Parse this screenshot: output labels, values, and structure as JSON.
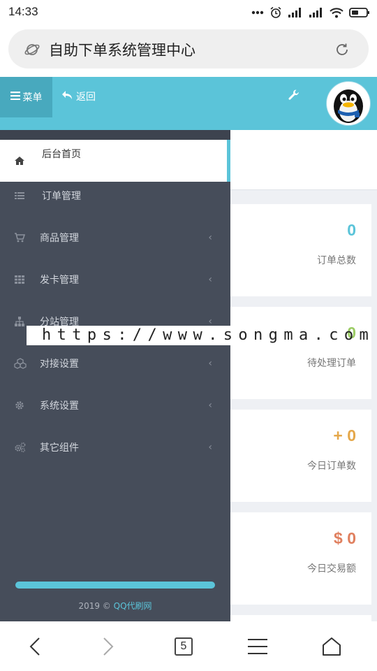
{
  "status_bar": {
    "time": "14:33"
  },
  "address_bar": {
    "title": "自助下单系统管理中心"
  },
  "header": {
    "menu_label": "菜单",
    "back_label": "返回"
  },
  "sidebar": {
    "items": [
      {
        "label": "后台首页",
        "icon": "home-icon",
        "active": true
      },
      {
        "label": "订单管理",
        "icon": "list-icon"
      },
      {
        "label": "商品管理",
        "icon": "cart-icon"
      },
      {
        "label": "发卡管理",
        "icon": "grid-icon"
      },
      {
        "label": "分站管理",
        "icon": "sitemap-icon"
      },
      {
        "label": "对接设置",
        "icon": "cubes-icon"
      },
      {
        "label": "系统设置",
        "icon": "gear-icon"
      },
      {
        "label": "其它组件",
        "icon": "gears-icon"
      }
    ],
    "footer_year": "2019 ©",
    "footer_brand": "QQ代刷网"
  },
  "stats": [
    {
      "value": "0",
      "label": "订单总数",
      "color": "#5bc4d9"
    },
    {
      "value": "0",
      "label": "待处理订单",
      "color": "#9ccc65"
    },
    {
      "value": "+ 0",
      "label": "今日订单数",
      "color": "#e5a84b"
    },
    {
      "value": "$ 0",
      "label": "今日交易额",
      "color": "#e0805f"
    }
  ],
  "watermark": {
    "text": "https://www.songma.com"
  },
  "bottom_nav": {
    "tab_count": "5"
  },
  "colors": {
    "accent": "#5bc4d9",
    "sidebar_bg": "#464d5a"
  }
}
